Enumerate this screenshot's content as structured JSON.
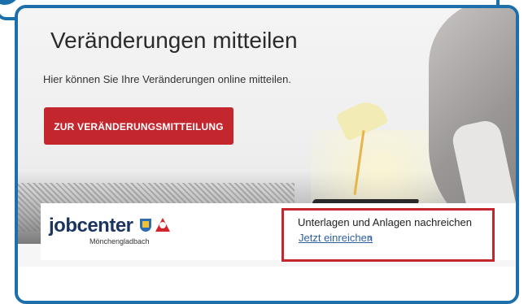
{
  "hero": {
    "title": "Veränderungen mitteilen",
    "lead": "Hier können Sie Ihre Veränderungen online mitteilen.",
    "cta_label": "ZUR VERÄNDERUNGSMITTEILUNG"
  },
  "callout_top": {
    "partial_text": "Veränderungen mitteilen"
  },
  "infobar": {
    "logo_word_prefix": "jobcenter",
    "logo_city": "Mönchengladbach",
    "title": "Unterlagen und Anlagen nachreichen",
    "link_label": "Jetzt einreichen",
    "chevron": "›"
  },
  "colors": {
    "frame": "#1c6fa8",
    "cta": "#c4262e",
    "highlight": "#c4262e",
    "link": "#2d5fa3"
  }
}
